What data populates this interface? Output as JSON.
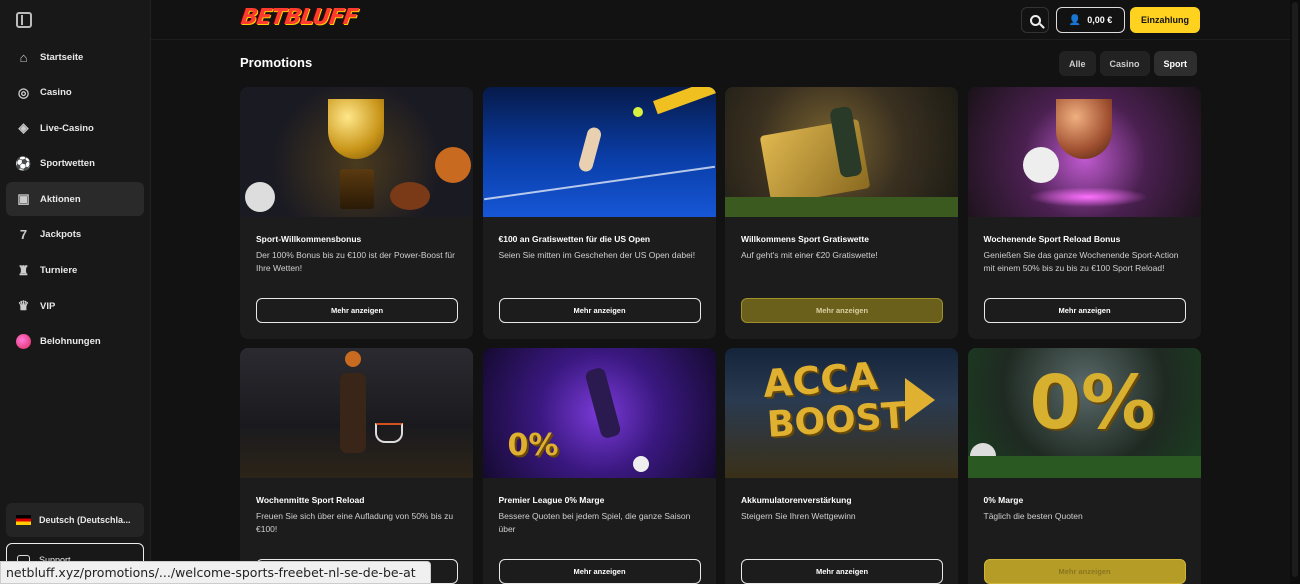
{
  "sidebar": {
    "items": [
      {
        "label": "Startseite",
        "icon": "home-icon",
        "glyph": "⌂"
      },
      {
        "label": "Casino",
        "icon": "casino-chip-icon",
        "glyph": "◎"
      },
      {
        "label": "Live-Casino",
        "icon": "live-casino-icon",
        "glyph": "◈"
      },
      {
        "label": "Sportwetten",
        "icon": "soccer-ball-icon",
        "glyph": "⚽"
      },
      {
        "label": "Aktionen",
        "icon": "gift-icon",
        "glyph": "▣"
      },
      {
        "label": "Jackpots",
        "icon": "seven-icon",
        "glyph": "7"
      },
      {
        "label": "Turniere",
        "icon": "trophy-icon",
        "glyph": "♜"
      },
      {
        "label": "VIP",
        "icon": "crown-icon",
        "glyph": "♛"
      },
      {
        "label": "Belohnungen",
        "icon": "rewards-icon",
        "glyph": "●"
      }
    ],
    "active_index": 4,
    "language": "Deutsch (Deutschla...",
    "support": "Support"
  },
  "header": {
    "logo": "BETBLUFF",
    "balance": "0,00 €",
    "deposit": "Einzahlung"
  },
  "main": {
    "title": "Promotions",
    "filters": [
      "Alle",
      "Casino",
      "Sport"
    ],
    "active_filter": "Sport",
    "cards": [
      {
        "title": "Sport-Willkommensbonus",
        "desc": "Der 100% Bonus bis zu €100 ist der Power-Boost für Ihre Wetten!",
        "button": "Mehr anzeigen",
        "button_style": "outline"
      },
      {
        "title": "€100 an Gratiswetten für die US Open",
        "desc": "Seien Sie mitten im Geschehen der US Open dabei!",
        "button": "Mehr anzeigen",
        "button_style": "outline"
      },
      {
        "title": "Willkommens Sport Gratiswette",
        "desc": "Auf geht's mit einer €20 Gratiswette!",
        "button": "Mehr anzeigen",
        "button_style": "gold"
      },
      {
        "title": "Wochenende Sport Reload Bonus",
        "desc": "Genießen Sie das ganze Wochenende Sport-Action mit einem 50% bis zu bis zu €100 Sport Reload!",
        "button": "Mehr anzeigen",
        "button_style": "outline"
      },
      {
        "title": "Wochenmitte Sport Reload",
        "desc": "Freuen Sie sich über eine Aufladung von 50% bis zu €100!",
        "button": "Mehr anzeigen",
        "button_style": "outline"
      },
      {
        "title": "Premier League 0% Marge",
        "desc": "Bessere Quoten bei jedem Spiel, die ganze Saison über",
        "button": "Mehr anzeigen",
        "button_style": "outline"
      },
      {
        "title": "Akkumulatorenverstärkung",
        "desc": "Steigern Sie Ihren Wettgewinn",
        "button": "Mehr anzeigen",
        "button_style": "outline"
      },
      {
        "title": "0% Marge",
        "desc": "Täglich die besten Quoten",
        "button": "Mehr anzeigen",
        "button_style": "gold-bright"
      }
    ],
    "art_text": {
      "card6_badge": "0%",
      "card7_line1": "ACCA",
      "card7_line2": "BOOST",
      "card8_big": "0%"
    }
  },
  "statusbar": {
    "url": "netbluff.xyz/promotions/.../welcome-sports-freebet-nl-se-de-be-at"
  },
  "colors": {
    "accent": "#ffd21f",
    "background": "#121212",
    "card": "#1c1c1c"
  }
}
